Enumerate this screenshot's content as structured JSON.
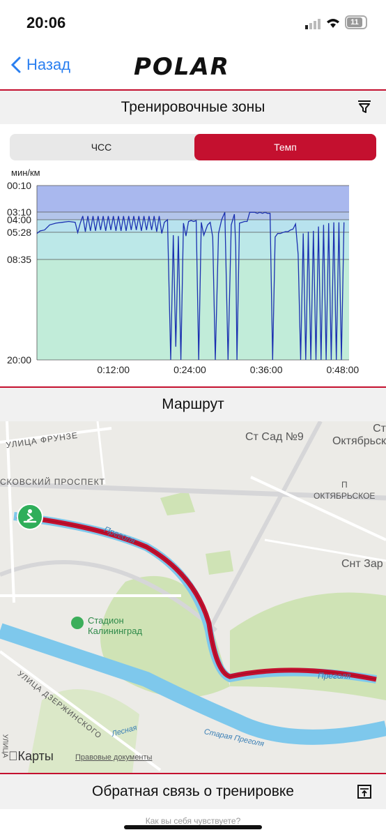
{
  "status": {
    "time": "20:06",
    "battery": "11"
  },
  "nav": {
    "back_label": "Назад",
    "logo": "POLAR"
  },
  "zones": {
    "title": "Тренировочные зоны",
    "tabs": [
      {
        "label": "ЧСС",
        "active": false
      },
      {
        "label": "Темп",
        "active": true
      }
    ],
    "y_unit": "мин/км"
  },
  "chart_data": {
    "type": "line",
    "ylabel": "мин/км",
    "y_ticks": [
      "00:10",
      "03:10",
      "04:00",
      "05:28",
      "08:35",
      "20:00"
    ],
    "x_ticks": [
      "0:12:00",
      "0:24:00",
      "0:36:00",
      "0:48:00"
    ],
    "zones": [
      {
        "from": "00:10",
        "to": "03:10",
        "color": "#a9b8ee"
      },
      {
        "from": "03:10",
        "to": "04:00",
        "color": "#b3c5ea"
      },
      {
        "from": "04:00",
        "to": "05:28",
        "color": "#b8e2ee"
      },
      {
        "from": "05:28",
        "to": "08:35",
        "color": "#bce8e8"
      },
      {
        "from": "08:35",
        "to": "20:00",
        "color": "#c1ecd9"
      }
    ],
    "series": [
      {
        "x": [
          0.0,
          0.5,
          1.2,
          2.0,
          3.0,
          4.0,
          5.0,
          6.0,
          6.4,
          6.8,
          7.2,
          7.6,
          8.0,
          8.4,
          8.8,
          9.2,
          9.6,
          10.0,
          10.4,
          10.8,
          11.2,
          11.6,
          12.0,
          12.4,
          12.8,
          13.2,
          13.6,
          14.0,
          14.4,
          14.8,
          15.2,
          15.6,
          16.0,
          16.4,
          16.8,
          17.2,
          17.6,
          18.0,
          18.4,
          18.8,
          19.2,
          19.6,
          20.0,
          20.5,
          21.0,
          21.4,
          21.8,
          22.2,
          22.6,
          23.0,
          23.4,
          23.8,
          24.2,
          24.6,
          25.0,
          25.4,
          25.8,
          26.2,
          26.8,
          27.2,
          27.6,
          28.0,
          28.5,
          29.0,
          29.5,
          30.0,
          30.5,
          31.0,
          31.2,
          31.4,
          31.8,
          32.2,
          32.6,
          33.0,
          33.4,
          33.8,
          34.2,
          34.6,
          35.0,
          35.4,
          35.8,
          36.2,
          36.6,
          37.0,
          37.4,
          37.8,
          38.2,
          38.6,
          39.0,
          39.4,
          39.8,
          40.2,
          40.6,
          41.0,
          41.4,
          41.8,
          42.2,
          42.6,
          43.0,
          43.4,
          43.8,
          44.2,
          44.6,
          45.0,
          45.4,
          45.8,
          46.2,
          46.6,
          47.0,
          47.4,
          47.8,
          48.2
        ],
        "y": [
          5.6,
          5.3,
          5.2,
          4.6,
          4.4,
          4.3,
          4.2,
          4.3,
          5.5,
          4.4,
          3.6,
          5.4,
          3.6,
          5.3,
          3.6,
          5.3,
          3.6,
          5.2,
          3.6,
          5.3,
          3.6,
          5.2,
          3.6,
          5.3,
          3.6,
          5.3,
          3.6,
          5.3,
          3.6,
          5.2,
          3.6,
          5.2,
          3.6,
          5.3,
          3.6,
          5.2,
          3.6,
          5.2,
          3.6,
          5.4,
          3.6,
          5.6,
          4.3,
          4.0,
          20.0,
          5.8,
          18.5,
          5.9,
          20.0,
          4.4,
          5.9,
          4.2,
          4.1,
          4.2,
          4.1,
          20.0,
          4.3,
          5.8,
          4.6,
          4.3,
          6.0,
          20.0,
          5.6,
          4.0,
          3.2,
          20.0,
          4.6,
          3.4,
          7.0,
          20.0,
          4.4,
          4.3,
          4.2,
          4.2,
          3.2,
          3.2,
          3.2,
          3.3,
          3.2,
          3.3,
          3.2,
          3.3,
          3.3,
          20.0,
          6.0,
          5.6,
          5.6,
          5.5,
          5.4,
          5.4,
          5.2,
          5.1,
          4.5,
          8.0,
          20.0,
          5.6,
          20.0,
          5.4,
          20.0,
          5.3,
          20.0,
          4.8,
          20.0,
          4.6,
          20.0,
          4.4,
          20.0,
          4.3,
          20.0,
          4.3,
          20.0,
          4.3
        ],
        "color": "#1a2fb0"
      }
    ]
  },
  "route": {
    "title": "Маршрут",
    "map_labels": {
      "frunze": "УЛИЦА ФРУНЗЕ",
      "moskovsky": "СКОВСКИЙ ПРОСПЕКТ",
      "sad9": "Ст Сад №9",
      "oktyabrskoe": "Ст Октябрьск",
      "p_oktyabrskoe": "ОКТЯБРЬСКОЕ",
      "p_letter": "П",
      "snt": "Снт Зар",
      "pregolya1": "Преголя",
      "pregolya2": "Преголя",
      "stadium": "Стадион Калининград",
      "dzerzhinskogo": "УЛИЦА ДЗЕРЖИНСКОГО",
      "lesnaya": "Лесная",
      "staraya": "Старая Преголя",
      "ulitsa": "УЛИЦА"
    },
    "maps_brand": "Карты",
    "legal": "Правовые документы"
  },
  "feedback": {
    "title": "Обратная связь о тренировке",
    "subtitle": "Как вы себя чувствуете?"
  }
}
